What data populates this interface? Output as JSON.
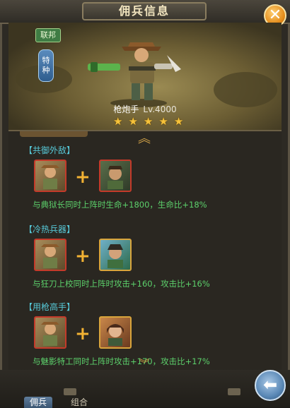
{
  "window": {
    "title": "佣兵信息"
  },
  "close": {
    "symbol": "✕"
  },
  "hero": {
    "faction": "联邦",
    "type": "特种",
    "name": "枪炮手",
    "level": "Lv.4000",
    "stars": 5
  },
  "combos": [
    {
      "title": "【共御外敌】",
      "desc": "与典狱长同时上阵时生命+1800，生命比+18%"
    },
    {
      "title": "【冷热兵器】",
      "desc": "与狂刀上校同时上阵时攻击+160，攻击比+16%"
    },
    {
      "title": "【用枪高手】",
      "desc": "与魅影特工同时上阵时攻击+170，攻击比+17%"
    }
  ],
  "plus": "+",
  "tabs": [
    "佣兵",
    "组合"
  ],
  "nav": {
    "up": "︽",
    "down": "︾",
    "back": "⬅"
  },
  "colors": {
    "accent": "#f2b233",
    "combo_title": "#57c9d8",
    "combo_desc": "#5cd06b"
  }
}
